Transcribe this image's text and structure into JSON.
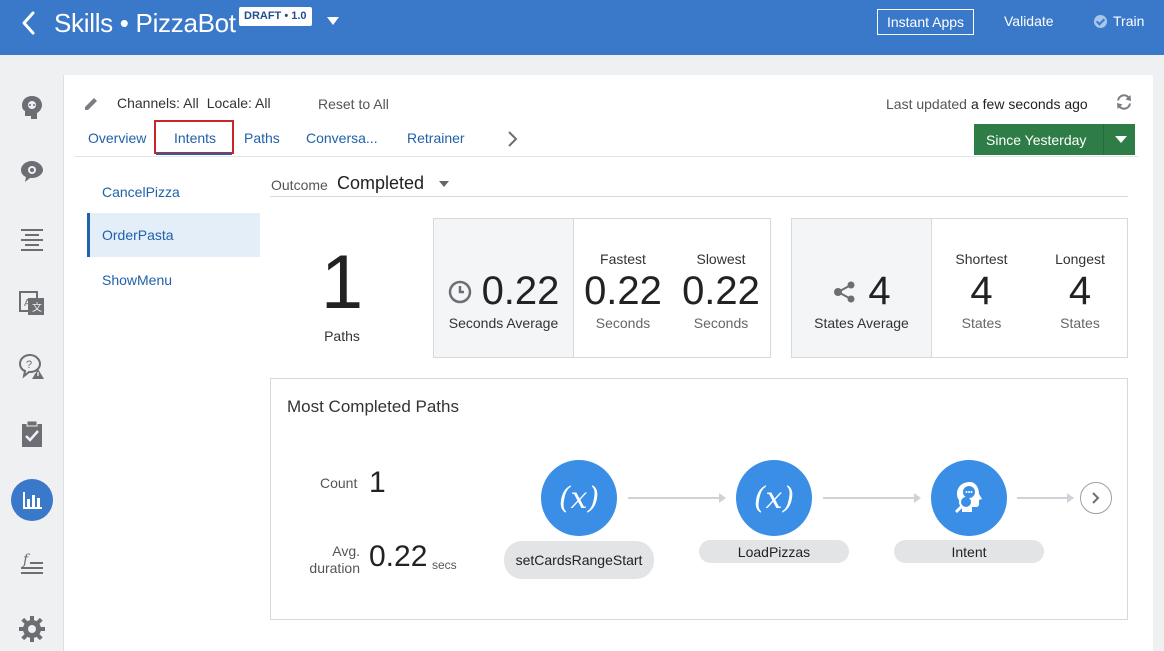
{
  "header": {
    "title": "Skills • PizzaBot",
    "badge": "DRAFT • 1.0",
    "instant_apps": "Instant Apps",
    "validate": "Validate",
    "train": "Train"
  },
  "sidebar": {
    "icons": [
      "intents-icon",
      "entities-icon",
      "flows-icon",
      "resource-bundles-icon",
      "quality-icon",
      "insights-checklist-icon",
      "insights-icon",
      "components-icon",
      "settings-icon"
    ],
    "active": "insights-icon"
  },
  "filters": {
    "channels_label": "Channels:",
    "channels_value": "All",
    "locale_label": "Locale:",
    "locale_value": "All",
    "reset": "Reset to All",
    "last_updated_label": "Last updated",
    "last_updated_value": "a few seconds ago"
  },
  "tabs": [
    "Overview",
    "Intents",
    "Paths",
    "Conversa...",
    "Retrainer"
  ],
  "active_tab": "Intents",
  "range": {
    "label": "Since Yesterday"
  },
  "intents": [
    "CancelPizza",
    "OrderPasta",
    "ShowMenu"
  ],
  "selected_intent": "OrderPasta",
  "outcome": {
    "label": "Outcome",
    "value": "Completed"
  },
  "paths": {
    "count": "1",
    "label": "Paths"
  },
  "duration": {
    "average": "0.22",
    "average_label": "Seconds Average",
    "fastest_label": "Fastest",
    "fastest": "0.22",
    "fastest_unit": "Seconds",
    "slowest_label": "Slowest",
    "slowest": "0.22",
    "slowest_unit": "Seconds"
  },
  "states": {
    "average": "4",
    "average_label": "States Average",
    "shortest_label": "Shortest",
    "shortest": "4",
    "shortest_unit": "States",
    "longest_label": "Longest",
    "longest": "4",
    "longest_unit": "States"
  },
  "most_completed": {
    "title": "Most Completed Paths",
    "count_label": "Count",
    "count": "1",
    "avg_label_line1": "Avg.",
    "avg_label_line2": "duration",
    "avg": "0.22",
    "avg_unit": "secs",
    "nodes": [
      {
        "symbol": "(x)",
        "label": "setCardsRangeStart"
      },
      {
        "symbol": "(x)",
        "label": "LoadPizzas"
      },
      {
        "symbol": "",
        "label": "Intent"
      }
    ]
  },
  "colors": {
    "brand": "#3a78c9",
    "accent_green": "#2e7d47",
    "node_blue": "#3a8ee6",
    "active_tab_outline": "#c9252d"
  }
}
